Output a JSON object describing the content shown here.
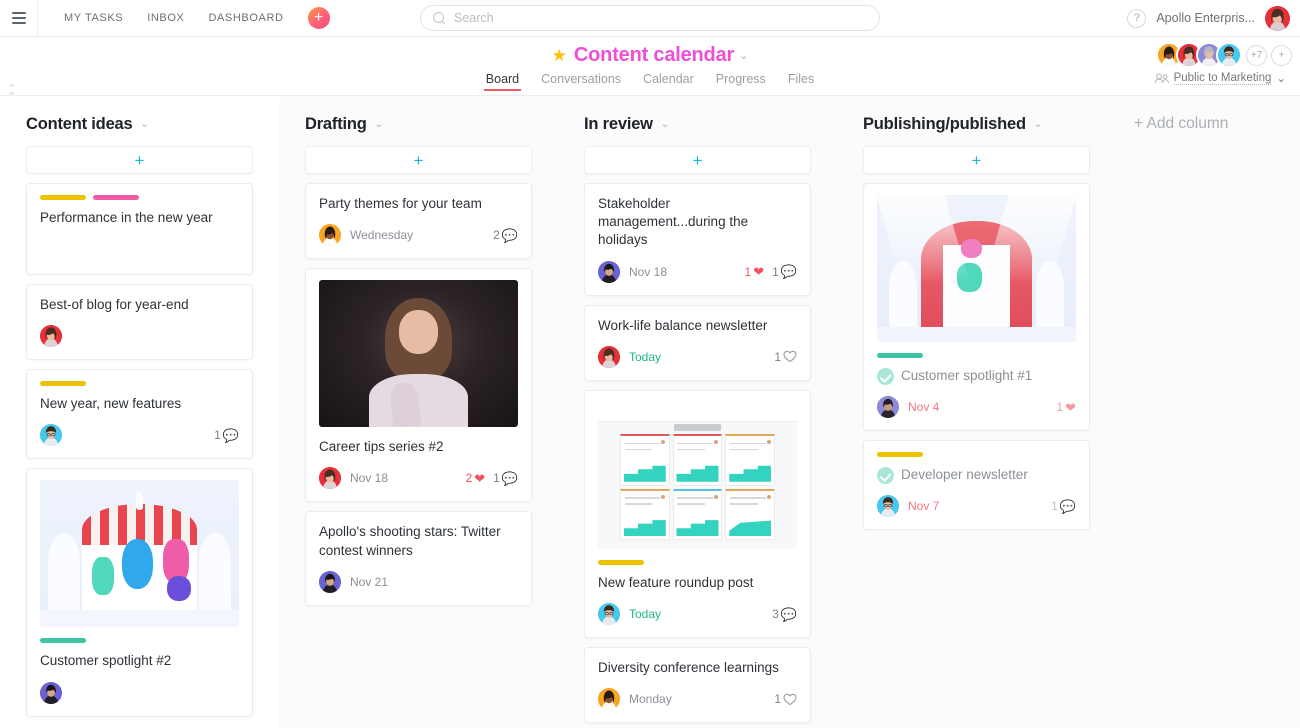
{
  "topbar": {
    "menu_icon": "hamburger-icon",
    "nav": [
      {
        "label": "MY TASKS"
      },
      {
        "label": "INBOX"
      },
      {
        "label": "DASHBOARD"
      }
    ],
    "add_label": "+",
    "search": {
      "placeholder": "Search",
      "value": "",
      "icon": "search-icon"
    },
    "help_label": "?",
    "workspace": "Apollo Enterpris...",
    "user_avatar": "user-avatar"
  },
  "project": {
    "star_icon": "star-icon",
    "title": "Content calendar",
    "title_caret": "⌄",
    "tabs": [
      {
        "label": "Board",
        "active": true
      },
      {
        "label": "Conversations",
        "active": false
      },
      {
        "label": "Calendar",
        "active": false
      },
      {
        "label": "Progress",
        "active": false
      },
      {
        "label": "Files",
        "active": false
      }
    ],
    "members_overflow": "+7",
    "add_member": "+",
    "privacy": "Public to Marketing",
    "privacy_caret": "⌄",
    "privacy_icon": "people-icon"
  },
  "board": {
    "add_column_label": "+ Add column",
    "add_card_label": "+",
    "collapse_icon": "collapse-chevron-icon",
    "columns": [
      {
        "title": "Content ideas",
        "highlighted": true,
        "cards": [
          {
            "title": "Performance in the new year",
            "tags": [
              "yellow",
              "pink"
            ],
            "avatar": "",
            "date": "",
            "hearts": "",
            "comments": "",
            "tall": true
          },
          {
            "title": "Best-of blog for year-end",
            "tags": [],
            "avatar": "face-red",
            "date": "",
            "hearts": "",
            "comments": ""
          },
          {
            "title": "New year, new features",
            "tags": [
              "yellow"
            ],
            "avatar": "face-blue",
            "date": "",
            "hearts": "",
            "comments": "1"
          },
          {
            "title": "Customer spotlight #2",
            "tags": [
              "teal"
            ],
            "avatar": "face-purple",
            "date": "",
            "hearts": "",
            "comments": "",
            "thumb": "circus-illustration"
          }
        ]
      },
      {
        "title": "Drafting",
        "highlighted": false,
        "cards": [
          {
            "title": "Party themes for your team",
            "tags": [],
            "avatar": "face-yellow",
            "date": "Wednesday",
            "date_state": "normal",
            "hearts": "",
            "comments": "2"
          },
          {
            "title": "Career tips series #2",
            "tags": [],
            "avatar": "face-red",
            "date": "Nov 18",
            "date_state": "normal",
            "hearts": "2",
            "comments": "1",
            "thumb": "woman-photo"
          },
          {
            "title": "Apollo's shooting stars: Twitter contest winners",
            "tags": [],
            "avatar": "face-purple",
            "date": "Nov 21",
            "date_state": "normal",
            "hearts": "",
            "comments": ""
          }
        ]
      },
      {
        "title": "In review",
        "highlighted": false,
        "cards": [
          {
            "title": "Stakeholder management...during the holidays",
            "tags": [],
            "avatar": "face-purple",
            "date": "Nov 18",
            "date_state": "normal",
            "hearts": "1",
            "comments": "1"
          },
          {
            "title": "Work-life balance newsletter",
            "tags": [],
            "avatar": "face-red",
            "date": "Today",
            "date_state": "today",
            "hearts": "",
            "likes_outline": "1"
          },
          {
            "title": "New feature roundup post",
            "tags": [
              "yellow"
            ],
            "avatar": "face-blue",
            "date": "Today",
            "date_state": "today",
            "hearts": "",
            "comments": "3",
            "thumb": "dashboard-screenshot"
          },
          {
            "title": "Diversity conference learnings",
            "tags": [],
            "avatar": "face-yellow",
            "date": "Monday",
            "date_state": "normal",
            "hearts": "",
            "likes_outline": "1"
          }
        ]
      },
      {
        "title": "Publishing/published",
        "highlighted": false,
        "cards": [
          {
            "title": "Customer spotlight #1",
            "tags": [
              "teal"
            ],
            "completed": true,
            "avatar": "face-lilac",
            "date": "Nov 4",
            "date_state": "overdue",
            "hearts": "1",
            "comments": "",
            "thumb": "circus-stage-illustration"
          },
          {
            "title": "Developer newsletter",
            "tags": [
              "yellow"
            ],
            "completed": true,
            "avatar": "face-blue",
            "date": "Nov 7",
            "date_state": "overdue",
            "hearts": "",
            "comments": "1",
            "comments_pale": true
          }
        ]
      }
    ]
  }
}
